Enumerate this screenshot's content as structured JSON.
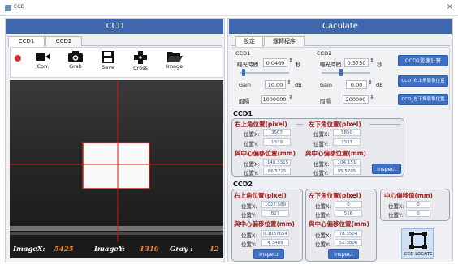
{
  "window": {
    "title": "CCD",
    "close": "×"
  },
  "left": {
    "header": "CCD",
    "tabs": [
      "CCD1",
      "CCD2"
    ],
    "toolbar": [
      "Con.",
      "Grab",
      "Save",
      "Cross",
      "Image"
    ],
    "status": {
      "x_label": "ImageX:",
      "x_value": "5425",
      "y_label": "ImageY:",
      "y_value": "1310",
      "gray_label": "Gray :",
      "gray_value": "12"
    }
  },
  "right": {
    "header": "Caculate",
    "tabs": [
      "設定",
      "運轉程序"
    ],
    "ccd1_settings": {
      "title": "CCD1",
      "exposure_label": "曝光時間",
      "exposure": "0.0469",
      "unit": "秒",
      "gain_label": "Gain",
      "gain": "10.00",
      "gain_unit": "dB",
      "interval_label": "間隔",
      "interval": "1000000"
    },
    "ccd2_settings": {
      "title": "CCD2",
      "exposure_label": "曝光時間",
      "exposure": "0.3750",
      "unit": "秒",
      "gain_label": "Gain",
      "gain": "0.00",
      "gain_unit": "dB",
      "interval_label": "間隔",
      "interval": "200000"
    },
    "side_buttons": [
      "CCD1影像計算",
      "CCD_右上角影像位置",
      "CCD_左下角影像位置"
    ],
    "ccd1": {
      "title": "CCD1",
      "top_right": {
        "title": "右上角位置(pixel)",
        "x_label": "位置X:",
        "x": "3567",
        "y_label": "位置Y:",
        "y": "1339"
      },
      "bottom_left": {
        "title": "左下角位置(pixel)",
        "x_label": "位置X:",
        "x": "5850",
        "y_label": "位置Y:",
        "y": "2337"
      },
      "offset1": {
        "title": "與中心偏移位置(mm)",
        "x_label": "位置X:",
        "x": "-148.3315",
        "y_label": "位置Y:",
        "y": "86.5725"
      },
      "offset2": {
        "title": "與中心偏移位置(mm)",
        "x_label": "位置X:",
        "x": "104.151",
        "y_label": "位置Y:",
        "y": "95.5705"
      },
      "inspect": "Inspect"
    },
    "ccd2": {
      "title": "CCD2",
      "top_right": {
        "title": "右上角位置(pixel)",
        "x_label": "位置X:",
        "x": "1027.589",
        "y_label": "位置Y:",
        "y": "827"
      },
      "offset1": {
        "title": "與中心偏移位置(mm)",
        "x_label": "位置X:",
        "x": "0.1087654",
        "y_label": "位置Y:",
        "y": "4.3489"
      },
      "bottom_left": {
        "title": "左下角位置(pixel)",
        "x_label": "位置X:",
        "x": "0",
        "y_label": "位置Y:",
        "y": "516"
      },
      "offset2": {
        "title": "與中心偏移位置(mm)",
        "x_label": "位置X:",
        "x": "78.3504",
        "y_label": "位置Y:",
        "y": "52.3806"
      },
      "center": {
        "title": "中心偏移值(mm)",
        "x_label": "位置X:",
        "x": "0",
        "y_label": "位置Y:",
        "y": "0"
      },
      "inspect": "Inspect",
      "locate": "CCD LOCATE"
    }
  }
}
